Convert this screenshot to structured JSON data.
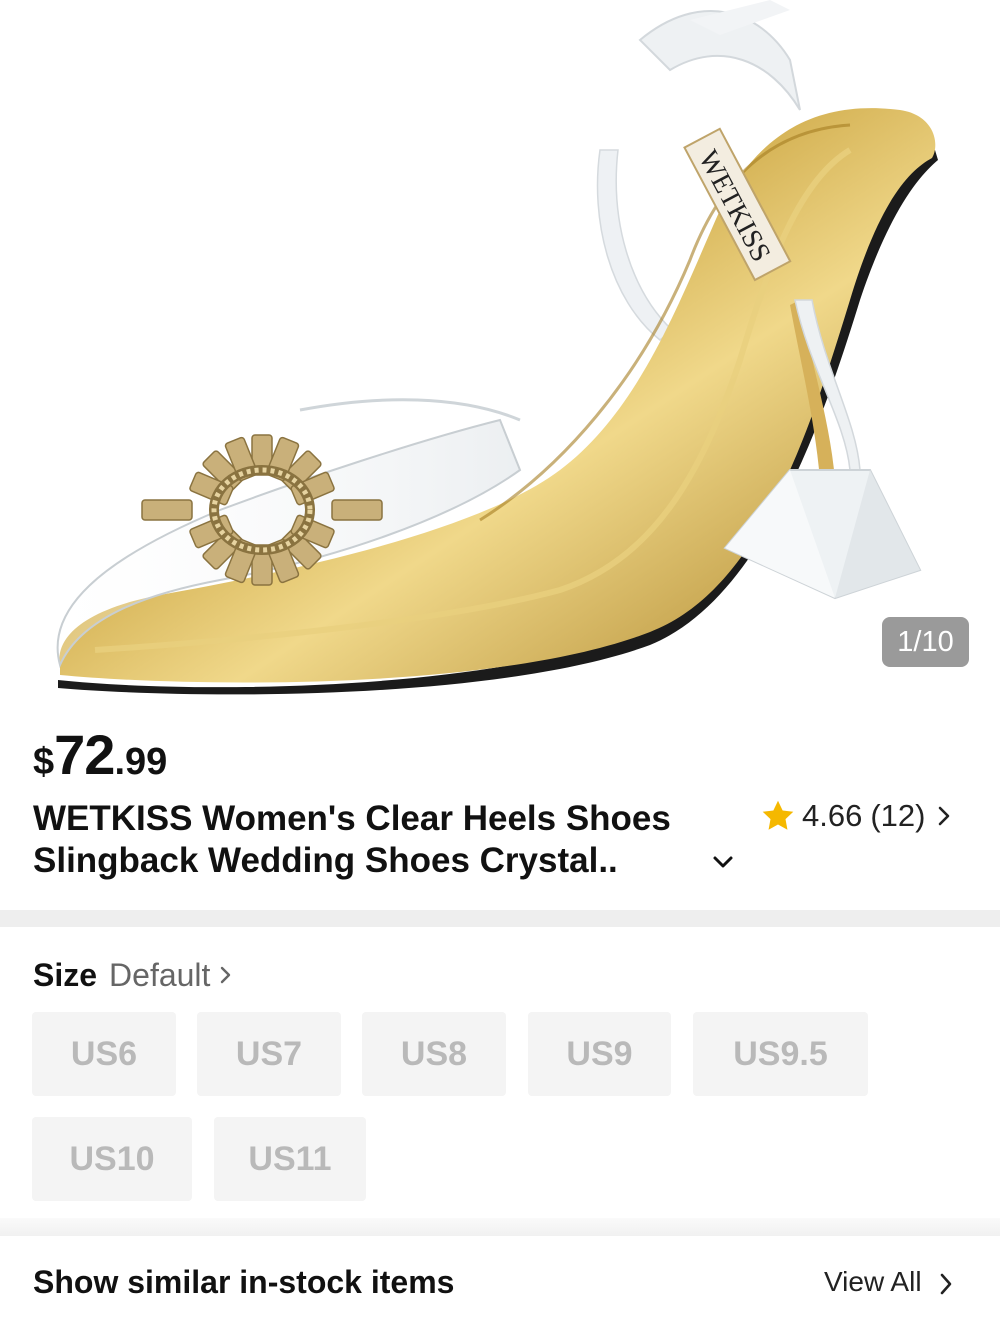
{
  "image": {
    "counter": "1/10",
    "brand_mark": "WETKISS"
  },
  "price": {
    "currency": "$",
    "whole": "72",
    "cents": ".99"
  },
  "title": {
    "line1": "WETKISS Women's Clear Heels Shoes",
    "line2": "Slingback Wedding Shoes Crystal.."
  },
  "rating": {
    "score": "4.66",
    "count": "(12)",
    "star_color": "#F5B800"
  },
  "size": {
    "label": "Size",
    "value": "Default",
    "options": [
      "US6",
      "US7",
      "US8",
      "US9",
      "US9.5",
      "US10",
      "US11"
    ]
  },
  "similar": {
    "label": "Show similar in-stock items",
    "view_all": "View All"
  },
  "colors": {
    "divider": "#EEEEEE",
    "size_bg": "#F4F4F4",
    "size_text": "#B9B9B9"
  }
}
